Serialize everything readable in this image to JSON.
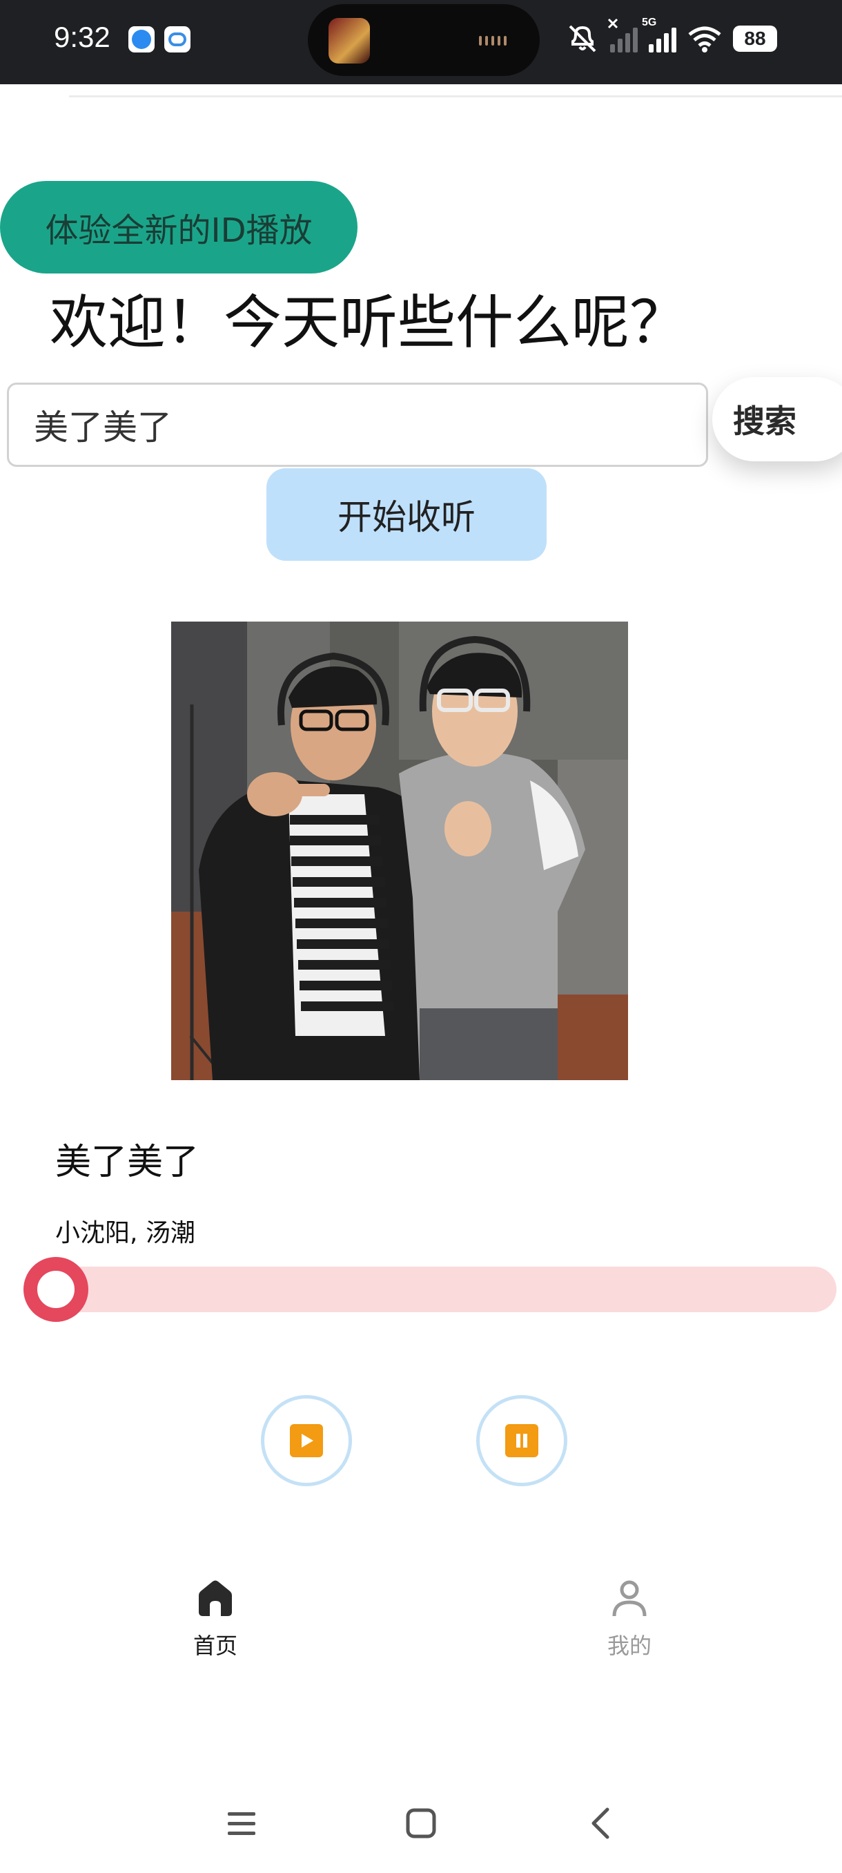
{
  "status_bar": {
    "time": "9:32",
    "battery": "88",
    "network": "5G",
    "icons": [
      "browser-app-icon",
      "cloud-app-icon",
      "mute-icon",
      "signal-icon",
      "wifi-icon",
      "battery-icon"
    ]
  },
  "banner": {
    "label": "体验全新的ID播放"
  },
  "header": {
    "welcome": "欢迎！今天听些什么呢？"
  },
  "search": {
    "value": "美了美了",
    "button_label": "搜索"
  },
  "listen": {
    "label": "开始收听"
  },
  "track": {
    "title": "美了美了",
    "artist": "小沈阳, 汤潮",
    "progress": 0
  },
  "controls": {
    "play_icon": "play-icon",
    "pause_icon": "pause-icon",
    "accent": "#f39b12"
  },
  "bottom_nav": {
    "items": [
      {
        "label": "首页",
        "icon": "home-icon",
        "active": true
      },
      {
        "label": "我的",
        "icon": "person-icon",
        "active": false
      }
    ]
  },
  "colors": {
    "banner_bg": "#1aa58a",
    "listen_bg": "#bfe0fb",
    "progress_thumb": "#e5475d",
    "progress_track": "#fbdadc"
  }
}
